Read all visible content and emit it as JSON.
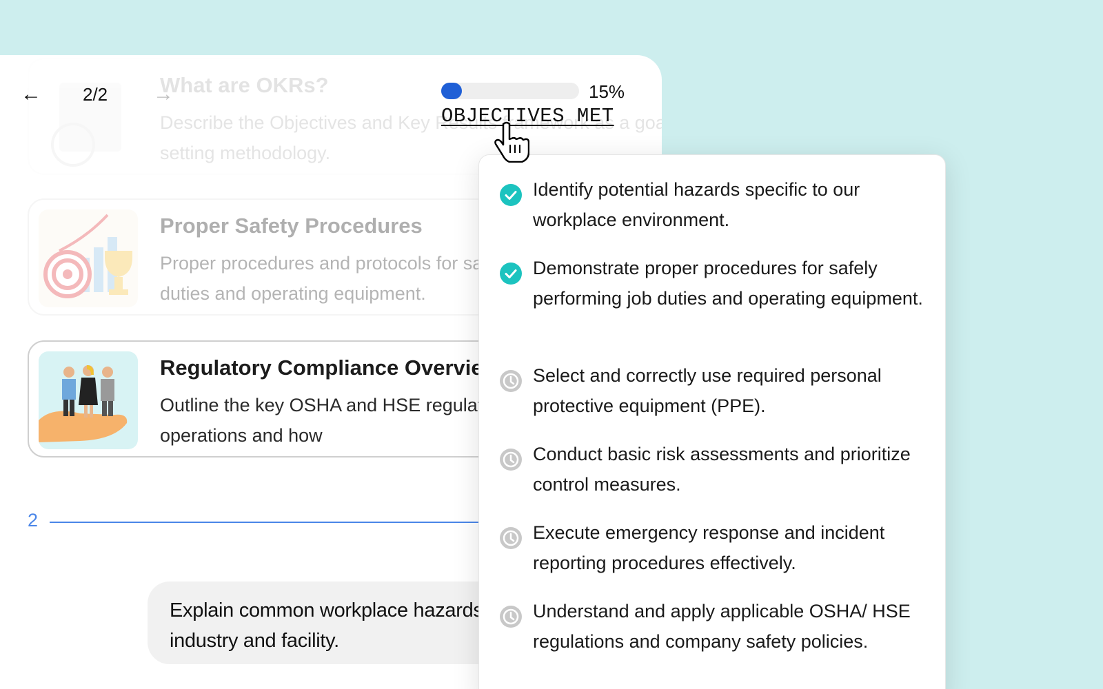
{
  "pager": {
    "back_glyph": "←",
    "forward_glyph": "→",
    "position": "2/2"
  },
  "progress": {
    "percent_label": "15%",
    "fraction": 0.15,
    "label": "OBJECTIVES MET",
    "fill_color": "#1f5fd6"
  },
  "cards": [
    {
      "title": "What are OKRs?",
      "description": "Describe the Objectives and Key Results framework as a goal-setting methodology."
    },
    {
      "title": "Proper Safety Procedures",
      "description": "Proper procedures and protocols for safely performing job duties and operating equipment."
    },
    {
      "title": "Regulatory Compliance Overview",
      "description": "Outline the key OSHA and HSE regulations relevant to our operations and how"
    }
  ],
  "section": {
    "number": "2"
  },
  "chat": {
    "message": "Explain common workplace hazards specific to our industry and facility."
  },
  "objectives": [
    {
      "text": "Identify potential hazards specific to our workplace environment.",
      "status": "complete"
    },
    {
      "text": "Demonstrate proper procedures for safely performing job duties and operating equipment.",
      "status": "complete"
    },
    {
      "text": "Select and correctly use required personal protective equipment (PPE).",
      "status": "pending"
    },
    {
      "text": "Conduct basic risk assessments and prioritize control measures.",
      "status": "pending"
    },
    {
      "text": "Execute emergency response and incident reporting procedures effectively.",
      "status": "pending"
    },
    {
      "text": "Understand and apply applicable OSHA/ HSE regulations and company safety policies.",
      "status": "pending"
    }
  ],
  "colors": {
    "background": "#cdeeee",
    "accent_teal": "#1cc3bf",
    "pending_gray": "#c8c8c8",
    "section_blue": "#4a86e8"
  },
  "icons": {
    "complete": "check-circle-icon",
    "pending": "clock-icon",
    "cursor": "hand-pointer-icon"
  }
}
